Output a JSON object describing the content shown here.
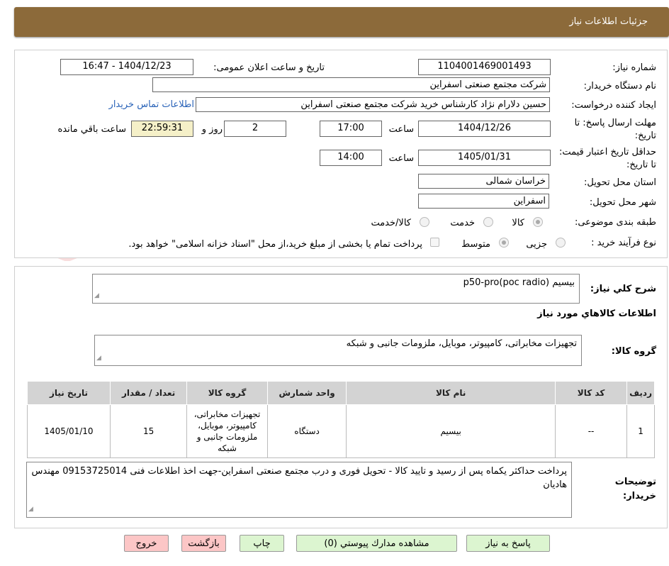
{
  "header": {
    "title": "جزئیات اطلاعات نیاز"
  },
  "form": {
    "need_number_label": "شماره نیاز:",
    "need_number": "1104001469001493",
    "announce_label": "تاریخ و ساعت اعلان عمومی:",
    "announce_value": "1404/12/23 - 16:47",
    "buyer_label": "نام دستگاه خریدار:",
    "buyer_value": "شرکت مجتمع صنعتی اسفراین",
    "creator_label": "ایجاد کننده درخواست:",
    "creator_value": "حسین دلارام نژاد کارشناس خرید شرکت مجتمع صنعتی اسفراین",
    "contact_link": "اطلاعات تماس خریدار",
    "deadline_label": "مهلت ارسال پاسخ: تا تاریخ:",
    "deadline_date": "1404/12/26",
    "time_label": "ساعت",
    "deadline_time": "17:00",
    "days_value": "2",
    "days_label": "روز و",
    "remaining_time": "22:59:31",
    "remaining_label": "ساعت باقي مانده",
    "validity_label": "حداقل تاریخ اعتبار قیمت: تا تاریخ:",
    "validity_date": "1405/01/31",
    "validity_time": "14:00",
    "province_label": "استان محل تحویل:",
    "province_value": "خراسان شمالی",
    "city_label": "شهر محل تحویل:",
    "city_value": "اسفراین",
    "category_label": "طبقه بندی موضوعی:",
    "category_options": [
      "کالا",
      "خدمت",
      "کالا/خدمت"
    ],
    "process_label": "نوع فرآیند خرید :",
    "process_options": [
      "جزیی",
      "متوسط"
    ],
    "payment_note": "پرداخت تمام یا بخشی از مبلغ خرید،از محل \"اسناد خزانه اسلامی\" خواهد بود."
  },
  "details": {
    "summary_label": "شرح كلي نياز:",
    "summary_value": "بیسیم  p50-pro(poc radio)",
    "goods_info_title": "اطلاعات کالاهاي مورد نياز",
    "goods_group_label": "گروه کالا:",
    "goods_group_value": "تجهیزات مخابراتی، کامپیوتر، موبایل، ملزومات جانبی و شبکه",
    "table": {
      "headers": [
        "رديف",
        "کد کالا",
        "نام کالا",
        "واحد شمارش",
        "گروه کالا",
        "تعداد / مقدار",
        "تاریخ نیاز"
      ],
      "rows": [
        [
          "1",
          "--",
          "بیسیم",
          "دستگاه",
          "تجهیزات مخابراتی، کامپیوتر، موبایل، ملزومات جانبی و شبکه",
          "15",
          "1405/01/10"
        ]
      ]
    },
    "buyer_notes_label": "توضیحات خریدار:",
    "buyer_notes_value": "پرداخت حداکثر یکماه پس از رسید و تایید کالا - تحویل فوری و درب مجتمع صنعتی اسفراین-جهت اخذ اطلاعات فنی 09153725014 مهندس هادیان"
  },
  "buttons": {
    "reply": "پاسخ به نیاز",
    "view_docs": "مشاهده مدارك پيوستي (0)",
    "print": "چاپ",
    "back": "بازگشت",
    "exit": "خروج"
  },
  "watermark": {
    "text": "AriaTender.neT"
  },
  "colors": {
    "header": "#8c6a3a",
    "link": "#2a63b8",
    "green_button": "#dcf5d0",
    "pink_button": "#fcc6c6",
    "yellow_field": "#f5f0c8"
  }
}
